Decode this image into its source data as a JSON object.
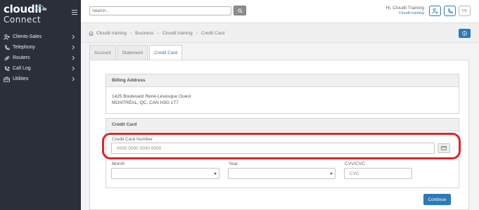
{
  "brand": {
    "name_top": "cloudli",
    "name_bottom": "Connect",
    "tm": "TM"
  },
  "sidebar": {
    "items": [
      {
        "label": "Clients-Sales",
        "icon": "user-plus-icon"
      },
      {
        "label": "Telephony",
        "icon": "phone-icon"
      },
      {
        "label": "Routers",
        "icon": "link-icon"
      },
      {
        "label": "Call Log",
        "icon": "call-log-icon"
      },
      {
        "label": "Utilities",
        "icon": "briefcase-icon"
      }
    ]
  },
  "topbar": {
    "search_placeholder": "Search...",
    "greeting": "Hi, Cloudli Training",
    "company": "Cloudli training",
    "lang": "FR"
  },
  "breadcrumb": [
    "Cloudli training",
    "Business",
    "Cloudli training",
    "Credit Card"
  ],
  "tabs": [
    {
      "label": "Account",
      "active": false
    },
    {
      "label": "Statement",
      "active": false
    },
    {
      "label": "Credit Card",
      "active": true
    }
  ],
  "billing": {
    "title": "Billing Address",
    "line1": "1425 Boulevard René-Lévesque Ouest",
    "line2": "MONTRÉAL, QC, CAN H3G 1T7"
  },
  "credit_card": {
    "title": "Credit Card",
    "number_label": "Credit Card Number",
    "number_placeholder": "0000 0000 0000 0000",
    "month_label": "Month",
    "year_label": "Year",
    "cvc_label": "CVV/CVC",
    "cvc_placeholder": "CVC",
    "submit": "Continue"
  },
  "colors": {
    "accent": "#2d7ab8",
    "sidebar_bg": "#2b2f3a",
    "highlight": "#d62828"
  }
}
